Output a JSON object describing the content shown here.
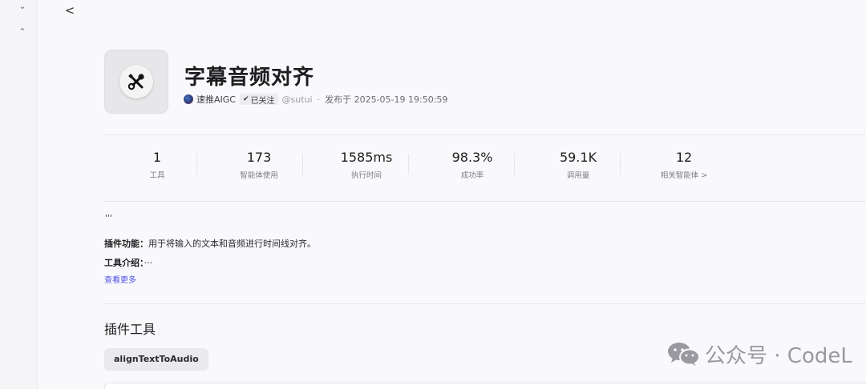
{
  "nav": {
    "collapse_icon": "chevron-down-icon",
    "expand_icon": "chevron-up-icon",
    "back_icon": "chevron-left-icon",
    "collapse_glyph": "⌄",
    "expand_glyph": "⌃",
    "back_glyph": "<"
  },
  "plugin": {
    "logo_icon": "scissors-tools-icon",
    "title": "字幕音频对齐",
    "author": "速推AIGC",
    "follow_status": "已关注",
    "handle": "@sutui",
    "separator": "·",
    "published": "发布于 2025-05-19 19:50:59"
  },
  "stats": [
    {
      "value": "1",
      "label": "工具"
    },
    {
      "value": "173",
      "label": "智能体使用"
    },
    {
      "value": "1585ms",
      "label": "执行时间"
    },
    {
      "value": "98.3%",
      "label": "成功率"
    },
    {
      "value": "59.1K",
      "label": "调用量"
    },
    {
      "value": "12",
      "label": "相关智能体 >"
    }
  ],
  "description": {
    "quote": "'''",
    "feature_label": "插件功能：",
    "feature_text": "用于将输入的文本和音频进行时间线对齐。",
    "intro_label": "工具介绍：",
    "intro_text": "···",
    "see_more": "查看更多"
  },
  "tools_section": {
    "title": "插件工具",
    "tools": [
      "alignTextToAudio"
    ]
  },
  "watermark": {
    "icon": "wechat-icon",
    "text": "公众号 · CodeL"
  },
  "colors": {
    "accent_link": "#4d53e8",
    "background": "#f9f9fb"
  }
}
